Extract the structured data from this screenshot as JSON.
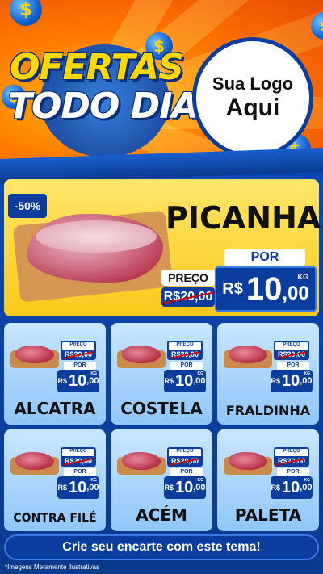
{
  "hero": {
    "title_line1": "OFERTAS",
    "title_line2": "TODO DIA",
    "logo_line1": "Sua Logo",
    "logo_line2": "Aqui",
    "coin_symbol": "$"
  },
  "featured": {
    "discount": "-50%",
    "name": "PICANHA",
    "preco_label": "PREÇO",
    "old_price": "R$20,00",
    "por_label": "POR",
    "currency": "R$",
    "price_int": "10",
    "price_cents": ",00",
    "unit": "KG"
  },
  "products": [
    {
      "name": "ALCATRA",
      "preco_label": "PREÇO",
      "old_price": "R$20,00",
      "por_label": "POR",
      "currency": "R$",
      "price_int": "10",
      "price_cents": ",00",
      "unit": "KG"
    },
    {
      "name": "COSTELA",
      "preco_label": "PREÇO",
      "old_price": "R$20,00",
      "por_label": "POR",
      "currency": "R$",
      "price_int": "10",
      "price_cents": ",00",
      "unit": "KG"
    },
    {
      "name": "FRALDINHA",
      "preco_label": "PREÇO",
      "old_price": "R$20,00",
      "por_label": "POR",
      "currency": "R$",
      "price_int": "10",
      "price_cents": ",00",
      "unit": "KG"
    },
    {
      "name": "CONTRA FILÉ",
      "preco_label": "PREÇO",
      "old_price": "R$20,00",
      "por_label": "POR",
      "currency": "R$",
      "price_int": "10",
      "price_cents": ",00",
      "unit": "KG"
    },
    {
      "name": "ACÉM",
      "preco_label": "PREÇO",
      "old_price": "R$20,00",
      "por_label": "POR",
      "currency": "R$",
      "price_int": "10",
      "price_cents": ",00",
      "unit": "KG"
    },
    {
      "name": "PALETA",
      "preco_label": "PREÇO",
      "old_price": "R$20,00",
      "por_label": "POR",
      "currency": "R$",
      "price_int": "10",
      "price_cents": ",00",
      "unit": "KG"
    }
  ],
  "cta": {
    "label": "Crie seu encarte com este tema!"
  },
  "footnote": "*Imagens Meramente Ilustrativas",
  "colors": {
    "brand_blue": "#0b3d9e",
    "accent_yellow": "#ffd800",
    "orange": "#ff7a00"
  }
}
